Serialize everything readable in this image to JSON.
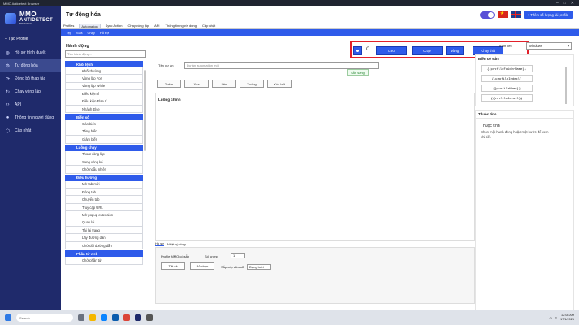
{
  "window": {
    "title": "MMO Antidetect Browser"
  },
  "logo": {
    "line1": "MMO",
    "line2": "ANTIDETECT",
    "line3": "BROWSER"
  },
  "sidebar": {
    "create_profile": "+ Tạo Profile",
    "items": [
      {
        "label": "Hồ sơ trình duyệt",
        "icon": "globe-icon"
      },
      {
        "label": "Tự động hóa",
        "icon": "robot-icon"
      },
      {
        "label": "Đồng bộ thao tác",
        "icon": "sync-icon"
      },
      {
        "label": "Chạy vòng lặp",
        "icon": "loop-icon"
      },
      {
        "label": "API",
        "icon": "code-icon"
      },
      {
        "label": "Thông tin người dùng",
        "icon": "user-icon"
      },
      {
        "label": "Cập nhật",
        "icon": "update-icon"
      }
    ]
  },
  "header": {
    "title": "Tự động hóa",
    "add_quota_label": "+ Thêm số lượng tài profile"
  },
  "top_tabs": [
    "Profiles",
    "Automation",
    "Sync Action",
    "Chạy vòng lặp",
    "API",
    "Thông tin người dùng",
    "Cập nhật"
  ],
  "sub_tabs": [
    "Tệp",
    "Sửa",
    "Chạy",
    "Hỗ trợ"
  ],
  "action_panel": {
    "title": "Hành động",
    "search_placeholder": "Tìm hành động...",
    "groups": [
      {
        "title": "Khối lệnh",
        "items": [
          "Khối thường",
          "Vòng lặp For",
          "Vòng lặp While",
          "Điều kiện If",
          "Điều kiện Else If",
          "Nhánh Else"
        ]
      },
      {
        "title": "Biến số",
        "items": [
          "Gán biến",
          "Tăng biến",
          "Giảm biến"
        ]
      },
      {
        "title": "Luồng chạy",
        "items": [
          "Thoát vòng lặp",
          "Sang vòng kế",
          "Chờ ngẫu nhiên"
        ]
      },
      {
        "title": "Điều hướng",
        "items": [
          "Mở tab mới",
          "Đóng tab",
          "Chuyển tab",
          "Truy cập URL",
          "Mở popup extension",
          "Quay lại",
          "Tải lại trang",
          "Lấy đường dẫn",
          "Chờ đổi đường dẫn"
        ]
      },
      {
        "title": "Phần tử web",
        "items": [
          "Chờ phần tử"
        ]
      }
    ]
  },
  "editor": {
    "toolbar": {
      "save": "Lưu",
      "run": "Chạy",
      "stop": "Dừng",
      "test_run": "Chạy thử"
    },
    "name_label": "Tên dự án",
    "name_placeholder": "Dự án automation mới",
    "status": "Sẵn sàng",
    "buttons": {
      "add": "Thêm",
      "delete": "Xóa",
      "up": "Lên",
      "down": "Xuống",
      "expand": "Xóa hết"
    },
    "main_flow": "Luồng chính"
  },
  "bottom": {
    "tabs": [
      "Hồ sơ",
      "Nhật ký chạy"
    ],
    "profile_label": "Profile MMO có sẵn",
    "count_label": "Số lượng",
    "count_value": "1",
    "btn_all": "Tất cả",
    "btn_deselect": "Bỏ chọn",
    "sort_label": "Sắp xếp cửa sổ",
    "sort_value": "Dạng lưới"
  },
  "right": {
    "browser_state_label": "Trình kết",
    "browser_value": "Windows",
    "vars_title": "Biến có sẵn",
    "vars": [
      "{{profileFolderName}}",
      "{{profileIndex}}",
      "{{profileName}}",
      "{{profileDetail}}"
    ],
    "props_title": "Thuộc tính",
    "props_sub": "Thuộc tính",
    "props_hint": "Chọn một hành động hoặc một bước để xem chi tiết."
  },
  "taskbar": {
    "search_placeholder": "Search",
    "time": "12:08 AM",
    "date": "17/1/2026"
  }
}
